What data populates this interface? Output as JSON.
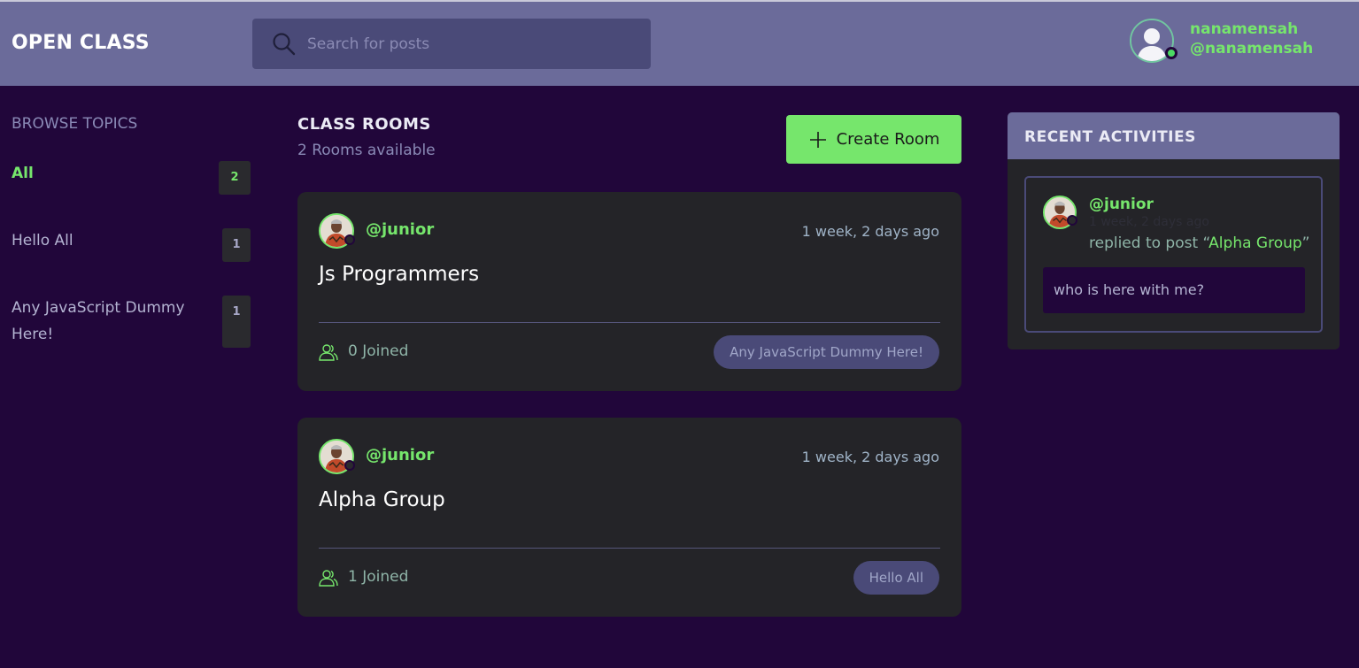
{
  "header": {
    "logo": "OPEN CLASS",
    "search_placeholder": "Search for posts",
    "search_value": "",
    "user": {
      "name": "nanamensah",
      "handle": "@nanamensah"
    }
  },
  "sidebar": {
    "title": "BROWSE TOPICS",
    "topics": [
      {
        "label": "All",
        "count": "2",
        "active": true
      },
      {
        "label": "Hello All",
        "count": "1"
      },
      {
        "label": "Any JavaScript Dummy Here!",
        "count": "1"
      }
    ]
  },
  "main": {
    "title": "CLASS ROOMS",
    "subtitle": "2 Rooms available",
    "create_label": "Create Room",
    "rooms": [
      {
        "host": "@junior",
        "time": "1 week, 2 days ago",
        "title": "Js Programmers",
        "joined": "0 Joined",
        "topic": "Any JavaScript Dummy Here!"
      },
      {
        "host": "@junior",
        "time": "1 week, 2 days ago",
        "title": "Alpha Group",
        "joined": "1 Joined",
        "topic": "Hello All"
      }
    ]
  },
  "activities": {
    "title": "RECENT ACTIVITIES",
    "items": [
      {
        "user": "@junior",
        "time": "1 week, 2 days ago",
        "action_prefix": "replied to post “",
        "post": "Alpha Group",
        "action_suffix": "”",
        "message": "who is here with me?"
      }
    ]
  },
  "colors": {
    "background": "#21063a",
    "header": "#6b6b9a",
    "accent_green": "#76e66c",
    "card": "#242428",
    "tag": "#4a4a78"
  },
  "icons": {
    "search": "search-icon",
    "plus": "plus-icon",
    "users": "users-icon",
    "avatar": "user-avatar-icon"
  }
}
